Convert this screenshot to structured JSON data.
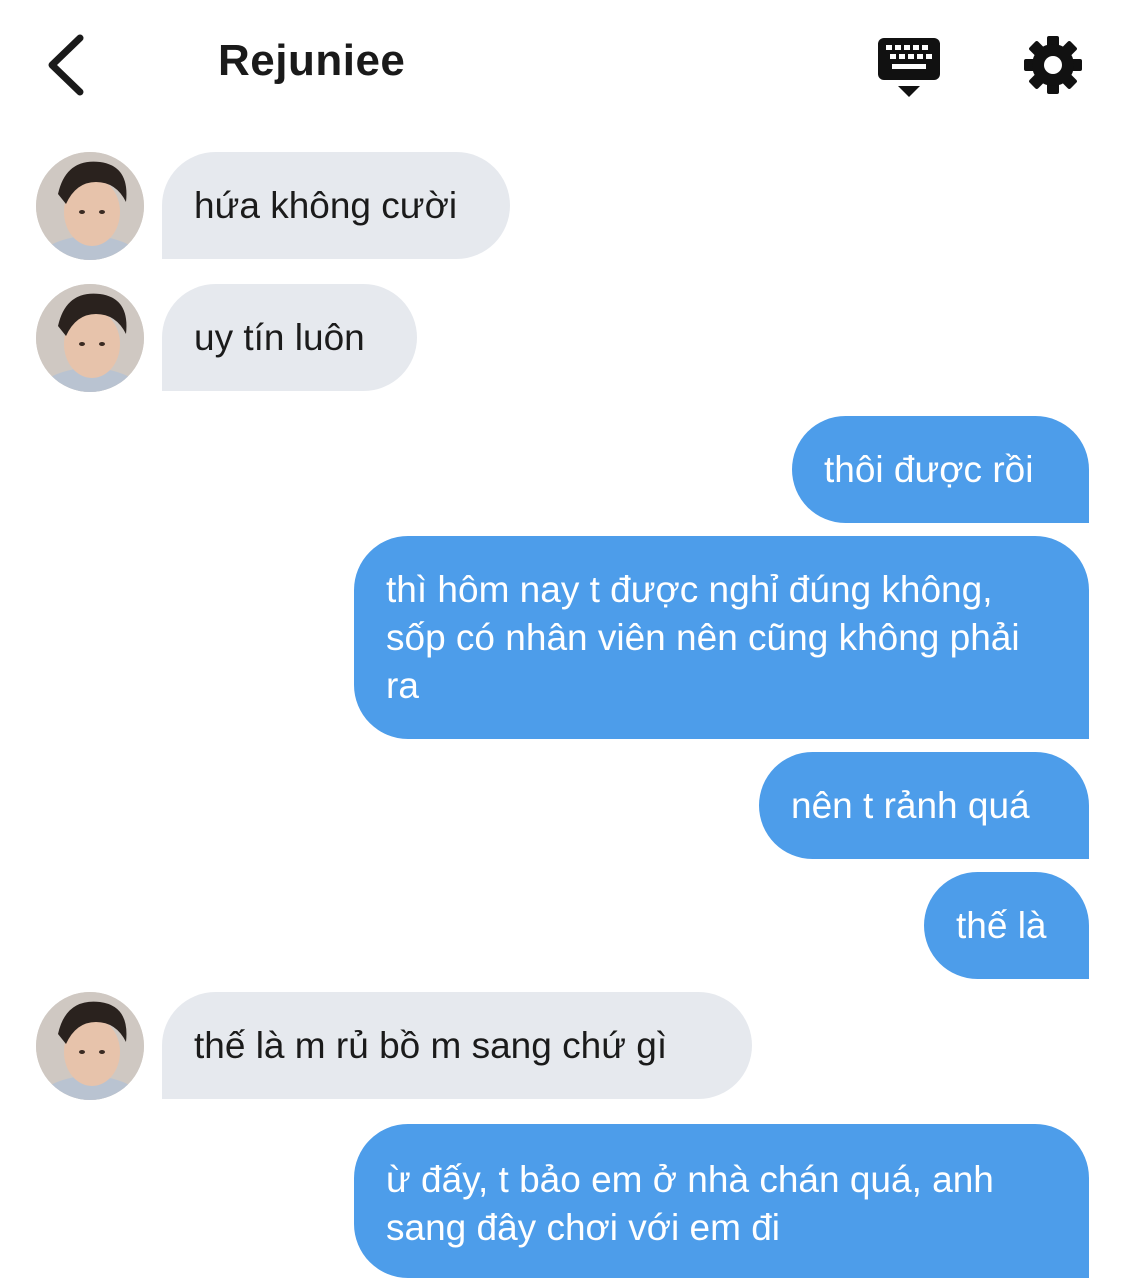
{
  "header": {
    "title": "Rejuniee",
    "back_icon": "chevron-left-icon",
    "keyboard_icon": "keyboard-icon",
    "settings_icon": "gear-icon"
  },
  "colors": {
    "incoming_bubble": "#e6e9ee",
    "outgoing_bubble": "#4d9dea",
    "outgoing_text": "#ffffff"
  },
  "messages": [
    {
      "direction": "incoming",
      "text": "hứa không cười"
    },
    {
      "direction": "incoming",
      "text": "uy tín luôn"
    },
    {
      "direction": "outgoing",
      "text": "thôi được rồi"
    },
    {
      "direction": "outgoing",
      "text": "thì hôm nay t được nghỉ đúng không, sốp có nhân viên nên cũng không phải ra"
    },
    {
      "direction": "outgoing",
      "text": "nên t rảnh quá"
    },
    {
      "direction": "outgoing",
      "text": "thế là"
    },
    {
      "direction": "incoming",
      "text": "thế là m rủ bồ m sang chứ gì"
    },
    {
      "direction": "outgoing",
      "text": "ừ đấy, t bảo em ở nhà chán quá, anh sang đây chơi với em đi"
    }
  ]
}
